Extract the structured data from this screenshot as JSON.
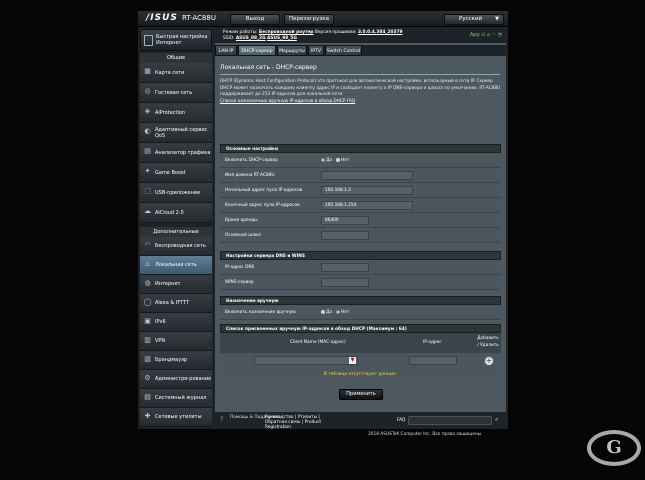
{
  "header": {
    "logo": "/ISUS",
    "model": "RT-AC88U",
    "logout_label": "Выход",
    "reboot_label": "Перезагрузка",
    "language": "Русский"
  },
  "status": {
    "mode_label": "Режим работы:",
    "mode_value": "Беспроводной роутер",
    "firmware_label": "Версия прошивки:",
    "firmware_value": "3.0.0.4.384_20379",
    "ssid_label": "SSID:",
    "ssid_1": "ASUS_88_2G",
    "ssid_2": "ASUS_88_5G",
    "app_label": "App"
  },
  "sidebar": {
    "quick_setup": "Быстрая настройка Интернет",
    "general_header": "Общие",
    "general_items": [
      {
        "label": "Карта сети",
        "icon": "network-map-icon",
        "glyph": "▦"
      },
      {
        "label": "Гостевая сеть",
        "icon": "guest-network-icon",
        "glyph": "◎"
      },
      {
        "label": "AiProtection",
        "icon": "shield-icon",
        "glyph": "◈"
      },
      {
        "label": "Адаптивный сервис QoS",
        "icon": "qos-icon",
        "glyph": "◐"
      },
      {
        "label": "Анализатор трафика",
        "icon": "traffic-analyzer-icon",
        "glyph": "▤"
      },
      {
        "label": "Game Boost",
        "icon": "game-boost-icon",
        "glyph": "✦"
      },
      {
        "label": "USB-приложение",
        "icon": "usb-icon",
        "glyph": "⬚"
      },
      {
        "label": "AiCloud 2.0",
        "icon": "cloud-icon",
        "glyph": "☁"
      }
    ],
    "advanced_header": "Дополнительные настройки",
    "advanced_items": [
      {
        "label": "Беспроводная сеть",
        "icon": "wireless-icon",
        "glyph": "◠"
      },
      {
        "label": "Локальная сеть",
        "icon": "lan-icon",
        "glyph": "⌂",
        "active": true
      },
      {
        "label": "Интернет",
        "icon": "globe-icon",
        "glyph": "◍"
      },
      {
        "label": "Alexa & IFTTT",
        "icon": "alexa-icon",
        "glyph": "◯"
      },
      {
        "label": "IPv6",
        "icon": "ipv6-icon",
        "glyph": "▣"
      },
      {
        "label": "VPN",
        "icon": "vpn-icon",
        "glyph": "▥"
      },
      {
        "label": "Брандмауэр",
        "icon": "firewall-icon",
        "glyph": "▧"
      },
      {
        "label": "Администри-рование",
        "icon": "admin-icon",
        "glyph": "⚙"
      },
      {
        "label": "Системный журнал",
        "icon": "log-icon",
        "glyph": "▤"
      },
      {
        "label": "Сетевые утилиты",
        "icon": "tools-icon",
        "glyph": "✚"
      }
    ]
  },
  "tabs": [
    "LAN IP",
    "DHCP-сервер",
    "Маршруты",
    "IPTV",
    "Switch Control"
  ],
  "page": {
    "title": "Локальная сеть - DHCP-сервер",
    "description": "DHCP (Dynamic Host Configuration Protocol) это протокол для автоматической настройки, использумый в сети IP. Сервер DHCP может назначать каждому клиенту адрес IP и сообщает клиенту о IP DNS-сервера и шлюза по умолчанию. RT-AC88U поддерживает до 253 IP-адресов для локальной сети.",
    "manual_link": "Список назначенных вручную IP-адресов в обход DHCP  FAQ"
  },
  "basic": {
    "header": "Основные настройки",
    "enable_label": "Включить DHCP-сервер",
    "yes": "Да",
    "no": "Нет",
    "domain_label": "Имя домена RT-AC88U",
    "domain_value": "",
    "start_label": "Начальный адрес пула IP-адресов",
    "start_value": "192.168.1.2",
    "end_label": "Конечный адрес пула IP-адресов",
    "end_value": "192.168.1.254",
    "lease_label": "Время аренды",
    "lease_value": "86400",
    "gateway_label": "Основной шлюз",
    "gateway_value": ""
  },
  "dns": {
    "header": "Настройки сервера DNS и WINS",
    "dns_label": "IP-адрес DNS",
    "wins_label": "WINS-сервер"
  },
  "manual": {
    "header": "Назначение вручную",
    "enable_label": "Включить назначение вручную",
    "yes": "Да",
    "no": "Нет"
  },
  "list": {
    "header": "Список присвоенных вручную IP-адресов в обход DHCP (Максимум : 64)",
    "col_client": "Client Name (MAC-адрес)",
    "col_ip": "IP-адрес",
    "col_action": "Добавить / Удалить",
    "empty": "В таблице отсутствуют данные."
  },
  "apply_label": "Применить",
  "footer": {
    "help": "Помощь & Поддержка",
    "links": "Руководство | Утилиты | Обратная связь | Product Registration",
    "faq": "FAQ"
  },
  "copyright": "2018 ASUSTeK Computer Inc. Все права защищены.",
  "watermark": "G"
}
